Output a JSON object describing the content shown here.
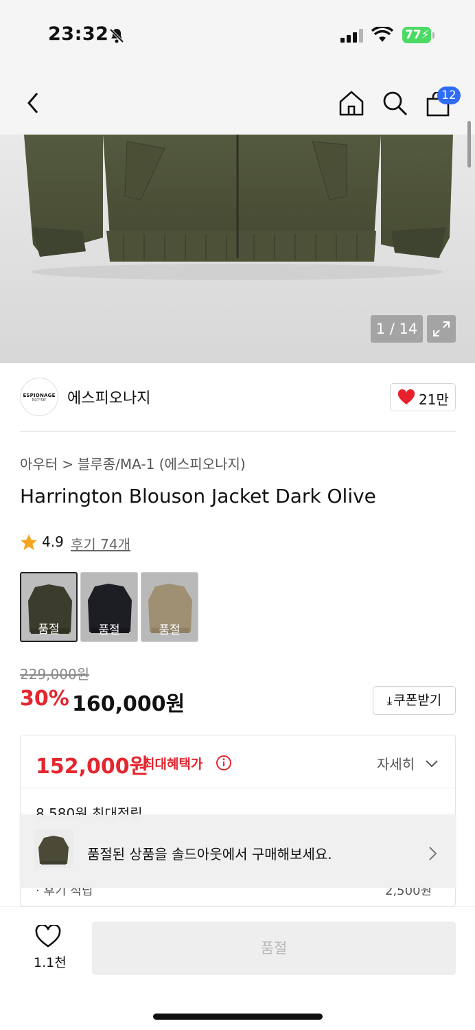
{
  "status_bar": {
    "time": "23:32",
    "battery": "77",
    "icons": [
      "bell-slash-icon",
      "cellular-signal-icon",
      "wifi-icon",
      "battery-icon"
    ]
  },
  "nav": {
    "cart_count": "12",
    "icons": [
      "back-chevron-icon",
      "home-icon",
      "search-icon",
      "shopping-bag-icon"
    ]
  },
  "gallery": {
    "counter": "1 / 14",
    "icons": [
      "expand-icon"
    ]
  },
  "brand": {
    "logo_line1": "ESPIONAGE",
    "logo_line2": "N37°56'",
    "name": "에스피오나지",
    "likes": "21만"
  },
  "breadcrumb": {
    "category": "아우터",
    "separator": ">",
    "subcategory": "블루종/MA-1 (에스피오나지)"
  },
  "product": {
    "title": "Harrington Blouson Jacket Dark Olive",
    "rating": "4.9",
    "reviews": "후기 74개",
    "rating_value": 4.9
  },
  "swatches": [
    {
      "label": "품절",
      "color": "#4a4a36"
    },
    {
      "label": "품절",
      "color": "#23252d"
    },
    {
      "label": "품절",
      "color": "#c3b08e"
    }
  ],
  "pricing": {
    "original": "229,000원",
    "discount": "30%",
    "sale": "160,000원",
    "coupon_label": "쿠폰받기",
    "coupon_icon": "download-icon"
  },
  "benefit": {
    "max_price": "152,000원",
    "max_label": "최대혜택가",
    "detail_label": "자세히",
    "points": "8,580원 최대적립",
    "review_label": "· 후기 적립",
    "review_value": "2,500원"
  },
  "toast": {
    "message": "품절된 상품을 솔드아웃에서 구매해보세요."
  },
  "bottom_bar": {
    "wish_count": "1.1천",
    "buy_label": "품절"
  },
  "colors": {
    "accent_red": "#e4262f",
    "badge_blue": "#2f6cf6",
    "heart_red": "#e8202a",
    "star": "#f4a521",
    "battery_green": "#4cd964"
  }
}
